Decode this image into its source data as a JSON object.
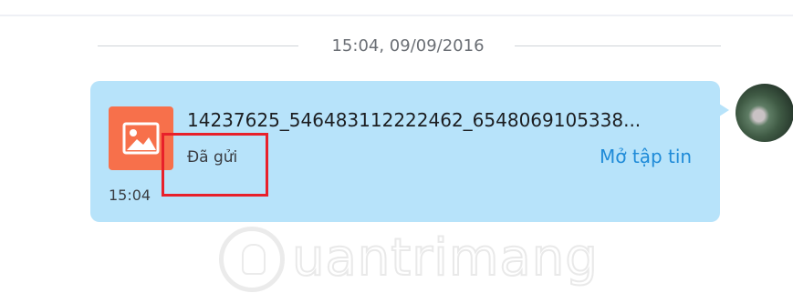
{
  "chat": {
    "date_separator": "15:04, 09/09/2016",
    "message": {
      "file_name": "14237625_546483112222462_6548069105338...",
      "status": "Đã gửi",
      "open_label": "Mở tập tin",
      "time": "15:04"
    }
  },
  "watermark": {
    "text": "uantrimang"
  },
  "colors": {
    "bubble": "#b7e3fa",
    "file_icon": "#f7704b",
    "link": "#1f8bd8",
    "highlight": "#e8202a"
  },
  "icons": {
    "file": "image-file-icon",
    "avatar": "user-avatar"
  }
}
